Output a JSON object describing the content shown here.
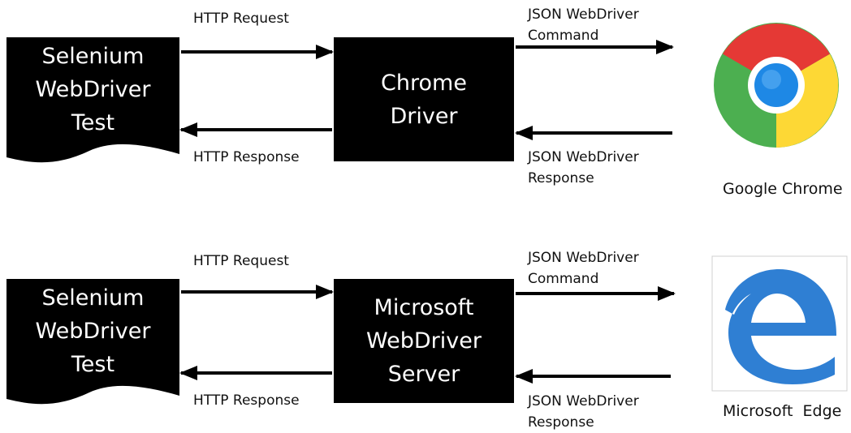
{
  "colors": {
    "box": "#000000",
    "box_text": "#ffffff",
    "arrow": "#000000",
    "edge_blue": "#2f7fd3"
  },
  "flows": [
    {
      "client_lines": [
        "Selenium",
        "WebDriver",
        "Test"
      ],
      "driver_lines": [
        "Chrome",
        "Driver"
      ],
      "request_label": "HTTP Request",
      "response_label": "HTTP Response",
      "command_lines": [
        "JSON WebDriver",
        "Command"
      ],
      "reply_lines": [
        "JSON WebDriver",
        "Response"
      ],
      "browser_name": "Google Chrome",
      "browser_icon": "chrome-logo-icon"
    },
    {
      "client_lines": [
        "Selenium",
        "WebDriver",
        "Test"
      ],
      "driver_lines": [
        "Microsoft",
        "WebDriver",
        "Server"
      ],
      "request_label": "HTTP Request",
      "response_label": "HTTP Response",
      "command_lines": [
        "JSON WebDriver",
        "Command"
      ],
      "reply_lines": [
        "JSON WebDriver",
        "Response"
      ],
      "browser_name": "Microsoft  Edge",
      "browser_icon": "edge-logo-icon"
    }
  ]
}
